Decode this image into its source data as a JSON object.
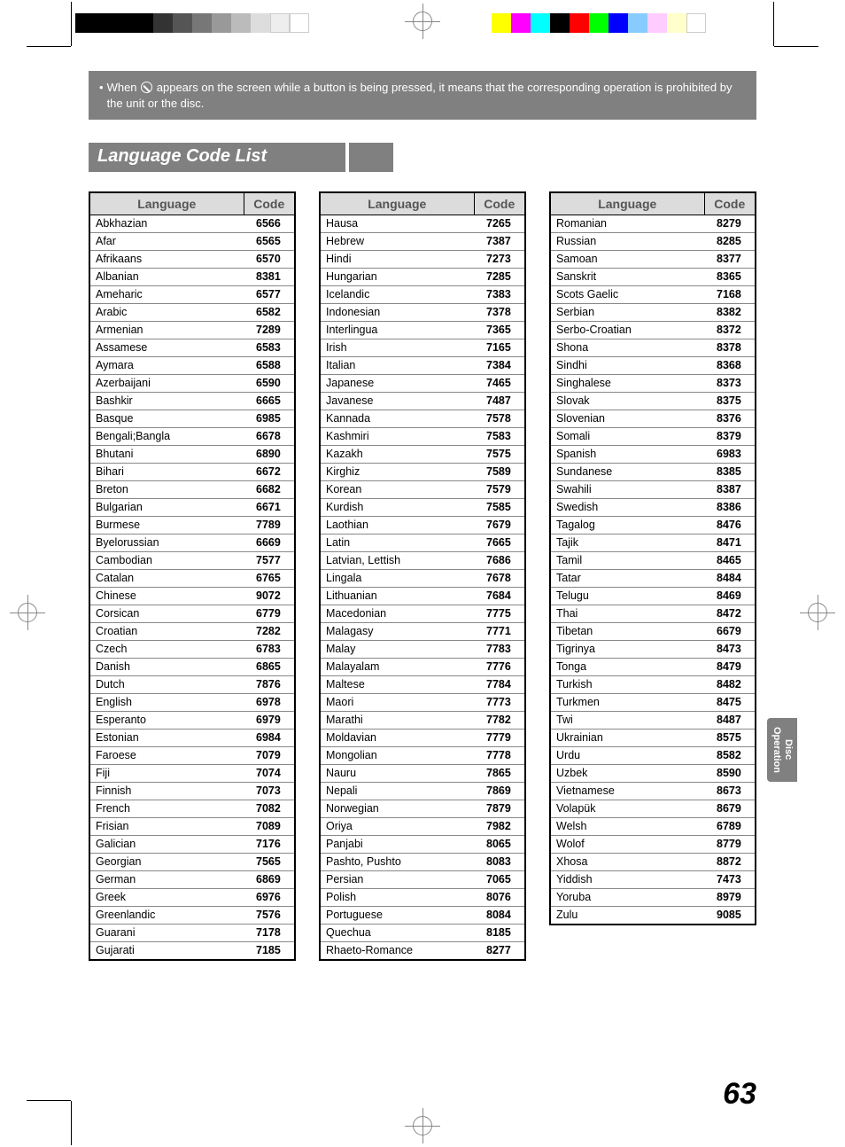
{
  "note": {
    "before": "When ",
    "after": " appears on the screen while a button is being pressed, it means that the corresponding operation is prohibited by the unit or the disc."
  },
  "section_title": "Language Code List",
  "headers": {
    "lang": "Language",
    "code": "Code"
  },
  "side_tab": {
    "line1": "Disc",
    "line2": "Operation"
  },
  "page_number": "63",
  "columns": [
    [
      {
        "lang": "Abkhazian",
        "code": "6566"
      },
      {
        "lang": "Afar",
        "code": "6565"
      },
      {
        "lang": "Afrikaans",
        "code": "6570"
      },
      {
        "lang": "Albanian",
        "code": "8381"
      },
      {
        "lang": "Ameharic",
        "code": "6577"
      },
      {
        "lang": "Arabic",
        "code": "6582"
      },
      {
        "lang": "Armenian",
        "code": "7289"
      },
      {
        "lang": "Assamese",
        "code": "6583"
      },
      {
        "lang": "Aymara",
        "code": "6588"
      },
      {
        "lang": "Azerbaijani",
        "code": "6590"
      },
      {
        "lang": "Bashkir",
        "code": "6665"
      },
      {
        "lang": "Basque",
        "code": "6985"
      },
      {
        "lang": "Bengali;Bangla",
        "code": "6678"
      },
      {
        "lang": "Bhutani",
        "code": "6890"
      },
      {
        "lang": "Bihari",
        "code": "6672"
      },
      {
        "lang": "Breton",
        "code": "6682"
      },
      {
        "lang": "Bulgarian",
        "code": "6671"
      },
      {
        "lang": "Burmese",
        "code": "7789"
      },
      {
        "lang": "Byelorussian",
        "code": "6669"
      },
      {
        "lang": "Cambodian",
        "code": "7577"
      },
      {
        "lang": "Catalan",
        "code": "6765"
      },
      {
        "lang": "Chinese",
        "code": "9072"
      },
      {
        "lang": "Corsican",
        "code": "6779"
      },
      {
        "lang": "Croatian",
        "code": "7282"
      },
      {
        "lang": "Czech",
        "code": "6783"
      },
      {
        "lang": "Danish",
        "code": "6865"
      },
      {
        "lang": "Dutch",
        "code": "7876"
      },
      {
        "lang": "English",
        "code": "6978"
      },
      {
        "lang": "Esperanto",
        "code": "6979"
      },
      {
        "lang": "Estonian",
        "code": "6984"
      },
      {
        "lang": "Faroese",
        "code": "7079"
      },
      {
        "lang": "Fiji",
        "code": "7074"
      },
      {
        "lang": "Finnish",
        "code": "7073"
      },
      {
        "lang": "French",
        "code": "7082"
      },
      {
        "lang": "Frisian",
        "code": "7089"
      },
      {
        "lang": "Galician",
        "code": "7176"
      },
      {
        "lang": "Georgian",
        "code": "7565"
      },
      {
        "lang": "German",
        "code": "6869"
      },
      {
        "lang": "Greek",
        "code": "6976"
      },
      {
        "lang": "Greenlandic",
        "code": "7576"
      },
      {
        "lang": "Guarani",
        "code": "7178"
      },
      {
        "lang": "Gujarati",
        "code": "7185"
      }
    ],
    [
      {
        "lang": "Hausa",
        "code": "7265"
      },
      {
        "lang": "Hebrew",
        "code": "7387"
      },
      {
        "lang": "Hindi",
        "code": "7273"
      },
      {
        "lang": "Hungarian",
        "code": "7285"
      },
      {
        "lang": "Icelandic",
        "code": "7383"
      },
      {
        "lang": "Indonesian",
        "code": "7378"
      },
      {
        "lang": "Interlingua",
        "code": "7365"
      },
      {
        "lang": "Irish",
        "code": "7165"
      },
      {
        "lang": "Italian",
        "code": "7384"
      },
      {
        "lang": "Japanese",
        "code": "7465"
      },
      {
        "lang": "Javanese",
        "code": "7487"
      },
      {
        "lang": "Kannada",
        "code": "7578"
      },
      {
        "lang": "Kashmiri",
        "code": "7583"
      },
      {
        "lang": "Kazakh",
        "code": "7575"
      },
      {
        "lang": "Kirghiz",
        "code": "7589"
      },
      {
        "lang": "Korean",
        "code": "7579"
      },
      {
        "lang": "Kurdish",
        "code": "7585"
      },
      {
        "lang": "Laothian",
        "code": "7679"
      },
      {
        "lang": "Latin",
        "code": "7665"
      },
      {
        "lang": "Latvian, Lettish",
        "code": "7686"
      },
      {
        "lang": "Lingala",
        "code": "7678"
      },
      {
        "lang": "Lithuanian",
        "code": "7684"
      },
      {
        "lang": "Macedonian",
        "code": "7775"
      },
      {
        "lang": "Malagasy",
        "code": "7771"
      },
      {
        "lang": "Malay",
        "code": "7783"
      },
      {
        "lang": "Malayalam",
        "code": "7776"
      },
      {
        "lang": "Maltese",
        "code": "7784"
      },
      {
        "lang": "Maori",
        "code": "7773"
      },
      {
        "lang": "Marathi",
        "code": "7782"
      },
      {
        "lang": "Moldavian",
        "code": "7779"
      },
      {
        "lang": "Mongolian",
        "code": "7778"
      },
      {
        "lang": "Nauru",
        "code": "7865"
      },
      {
        "lang": "Nepali",
        "code": "7869"
      },
      {
        "lang": "Norwegian",
        "code": "7879"
      },
      {
        "lang": "Oriya",
        "code": "7982"
      },
      {
        "lang": "Panjabi",
        "code": "8065"
      },
      {
        "lang": "Pashto, Pushto",
        "code": "8083"
      },
      {
        "lang": "Persian",
        "code": "7065"
      },
      {
        "lang": "Polish",
        "code": "8076"
      },
      {
        "lang": "Portuguese",
        "code": "8084"
      },
      {
        "lang": "Quechua",
        "code": "8185"
      },
      {
        "lang": "Rhaeto-Romance",
        "code": "8277"
      }
    ],
    [
      {
        "lang": "Romanian",
        "code": "8279"
      },
      {
        "lang": "Russian",
        "code": "8285"
      },
      {
        "lang": "Samoan",
        "code": "8377"
      },
      {
        "lang": "Sanskrit",
        "code": "8365"
      },
      {
        "lang": "Scots Gaelic",
        "code": "7168"
      },
      {
        "lang": "Serbian",
        "code": "8382"
      },
      {
        "lang": "Serbo-Croatian",
        "code": "8372"
      },
      {
        "lang": "Shona",
        "code": "8378"
      },
      {
        "lang": "Sindhi",
        "code": "8368"
      },
      {
        "lang": "Singhalese",
        "code": "8373"
      },
      {
        "lang": "Slovak",
        "code": "8375"
      },
      {
        "lang": "Slovenian",
        "code": "8376"
      },
      {
        "lang": "Somali",
        "code": "8379"
      },
      {
        "lang": "Spanish",
        "code": "6983"
      },
      {
        "lang": "Sundanese",
        "code": "8385"
      },
      {
        "lang": "Swahili",
        "code": "8387"
      },
      {
        "lang": "Swedish",
        "code": "8386"
      },
      {
        "lang": "Tagalog",
        "code": "8476"
      },
      {
        "lang": "Tajik",
        "code": "8471"
      },
      {
        "lang": "Tamil",
        "code": "8465"
      },
      {
        "lang": "Tatar",
        "code": "8484"
      },
      {
        "lang": "Telugu",
        "code": "8469"
      },
      {
        "lang": "Thai",
        "code": "8472"
      },
      {
        "lang": "Tibetan",
        "code": "6679"
      },
      {
        "lang": "Tigrinya",
        "code": "8473"
      },
      {
        "lang": "Tonga",
        "code": "8479"
      },
      {
        "lang": "Turkish",
        "code": "8482"
      },
      {
        "lang": "Turkmen",
        "code": "8475"
      },
      {
        "lang": "Twi",
        "code": "8487"
      },
      {
        "lang": "Ukrainian",
        "code": "8575"
      },
      {
        "lang": "Urdu",
        "code": "8582"
      },
      {
        "lang": "Uzbek",
        "code": "8590"
      },
      {
        "lang": "Vietnamese",
        "code": "8673"
      },
      {
        "lang": "Volapük",
        "code": "8679"
      },
      {
        "lang": "Welsh",
        "code": "6789"
      },
      {
        "lang": "Wolof",
        "code": "8779"
      },
      {
        "lang": "Xhosa",
        "code": "8872"
      },
      {
        "lang": "Yiddish",
        "code": "7473"
      },
      {
        "lang": "Yoruba",
        "code": "8979"
      },
      {
        "lang": "Zulu",
        "code": "9085"
      }
    ]
  ]
}
